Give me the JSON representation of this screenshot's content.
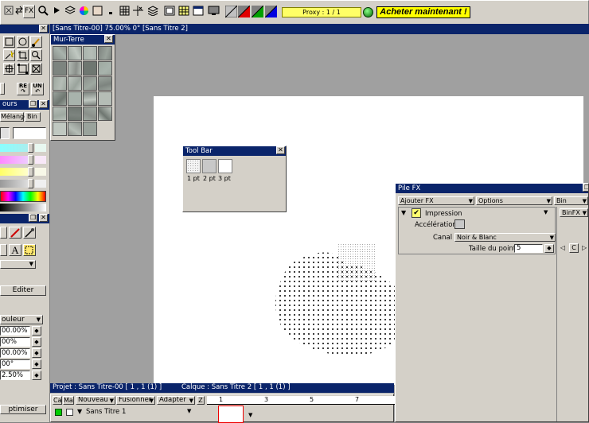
{
  "toolbar": {
    "fx_label": "FX",
    "proxy_text": "Proxy : 1 / 1",
    "buy_label": "Acheter maintenant !"
  },
  "document": {
    "title": "[Sans Titre-00]  75.00%   0°  [Sans Titre 2]",
    "status_projet": "Projet : Sans Titre-00 [ 1 , 1   (1) ]",
    "status_calque": "Calque : Sans Titre 2 [ 1 , 1   (1) ]"
  },
  "mur_terre": {
    "title": "Mur-Terre"
  },
  "tool_bar_panel": {
    "title": "Tool Bar",
    "items": [
      {
        "label": "1 pt"
      },
      {
        "label": "2 pt"
      },
      {
        "label": "3 pt"
      }
    ]
  },
  "left_panel": {
    "tools_undo": "UN",
    "tools_redo": "RE",
    "colors_title": "ours",
    "tab_melange": "Mélange",
    "tab_bin": "Bin",
    "editer_button": "Editer",
    "mode_dropdown": "ouleur",
    "fields": [
      "00.00%",
      "00%",
      "00.00%",
      "00°",
      "2.50%"
    ],
    "optimiser_button": "ptimiser"
  },
  "layers": {
    "col_ca": "Ca",
    "col_ma": "Ma",
    "nouveau": "Nouveau",
    "fusionner": "Fusionner",
    "adapter": "Adapter",
    "z": "Z",
    "layer_name": "Sans Titre 1",
    "ruler": [
      "1",
      "3",
      "5",
      "7"
    ]
  },
  "pile_fx": {
    "title": "Pile FX",
    "ajouter_fx": "Ajouter FX",
    "options": "Options",
    "bin": "Bin",
    "binfx": "BinFX",
    "effect_name": "Impression",
    "acceleration_label": "Accélération",
    "canal_label": "Canal",
    "canal_value": "Noir & Blanc",
    "taille_label": "Taille du point",
    "taille_value": "5",
    "c_button": "C"
  },
  "colors": {
    "titlebar": "#0a246a",
    "panel": "#d4d0c8",
    "workspace": "#808080",
    "buy_bg": "#ffff00",
    "proxy_bg": "#ffff66"
  }
}
